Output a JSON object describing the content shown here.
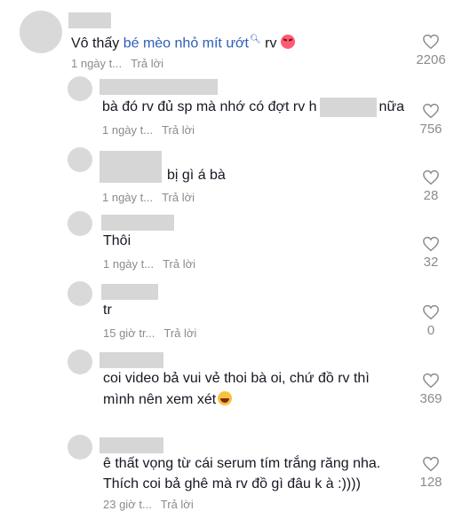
{
  "comments": [
    {
      "text_before": "Vô thấy ",
      "link": "bé mèo nhỏ mít ướt",
      "search_icon": "search-icon",
      "text_after": " rv",
      "emoji": "face-with-steam-emoji",
      "time": "1 ngày t...",
      "reply": "Trả lời",
      "likes": "2206"
    },
    {
      "text_before": "bà đó rv đủ sp mà nhớ có đợt rv h",
      "text_after": "nữa",
      "time": "1 ngày t...",
      "reply": "Trả lời",
      "likes": "756"
    },
    {
      "text": "bị gì á bà",
      "time": "1 ngày t...",
      "reply": "Trả lời",
      "likes": "28"
    },
    {
      "text": "Thôi",
      "time": "1 ngày t...",
      "reply": "Trả lời",
      "likes": "32"
    },
    {
      "text": "tr",
      "time": "15 giờ tr...",
      "reply": "Trả lời",
      "likes": "0"
    },
    {
      "line1": "coi video bả vui vẻ thoi bà oi, chứ đồ rv thì",
      "line2": "mình nên xem xét",
      "emoji": "laughing-emoji",
      "likes": "369"
    },
    {
      "line1": "ê thất vọng từ cái serum tím trắng răng nha.",
      "line2": "Thích coi bả ghê mà rv đồ gì đâu k à :))))",
      "time": "23 giờ t...",
      "reply": "Trả lời",
      "likes": "128"
    }
  ],
  "icons": {
    "like": "heart-outline-icon"
  },
  "colors": {
    "link": "#2b5db9",
    "meta": "#8a8b91",
    "text": "#161823"
  }
}
